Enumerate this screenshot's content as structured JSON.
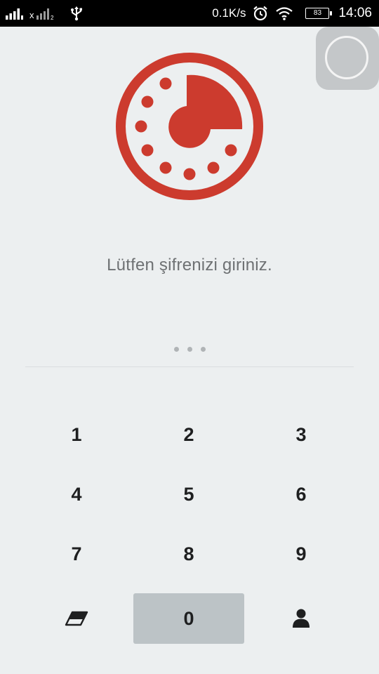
{
  "status_bar": {
    "network_speed": "0.1K/s",
    "battery_level": "83",
    "time": "14:06",
    "icons": [
      "signal-icon",
      "no-sim-signal-icon",
      "usb-icon",
      "alarm-clock-icon",
      "wifi-icon",
      "battery-icon"
    ]
  },
  "lock_screen": {
    "prompt": "Lütfen şifrenizi giriniz.",
    "entered_digits": 3,
    "accent_color": "#cc3b2e"
  },
  "keypad": {
    "keys": [
      "1",
      "2",
      "3",
      "4",
      "5",
      "6",
      "7",
      "8",
      "9"
    ],
    "zero": "0",
    "left_action_icon": "eraser-icon",
    "right_action_icon": "person-icon"
  }
}
